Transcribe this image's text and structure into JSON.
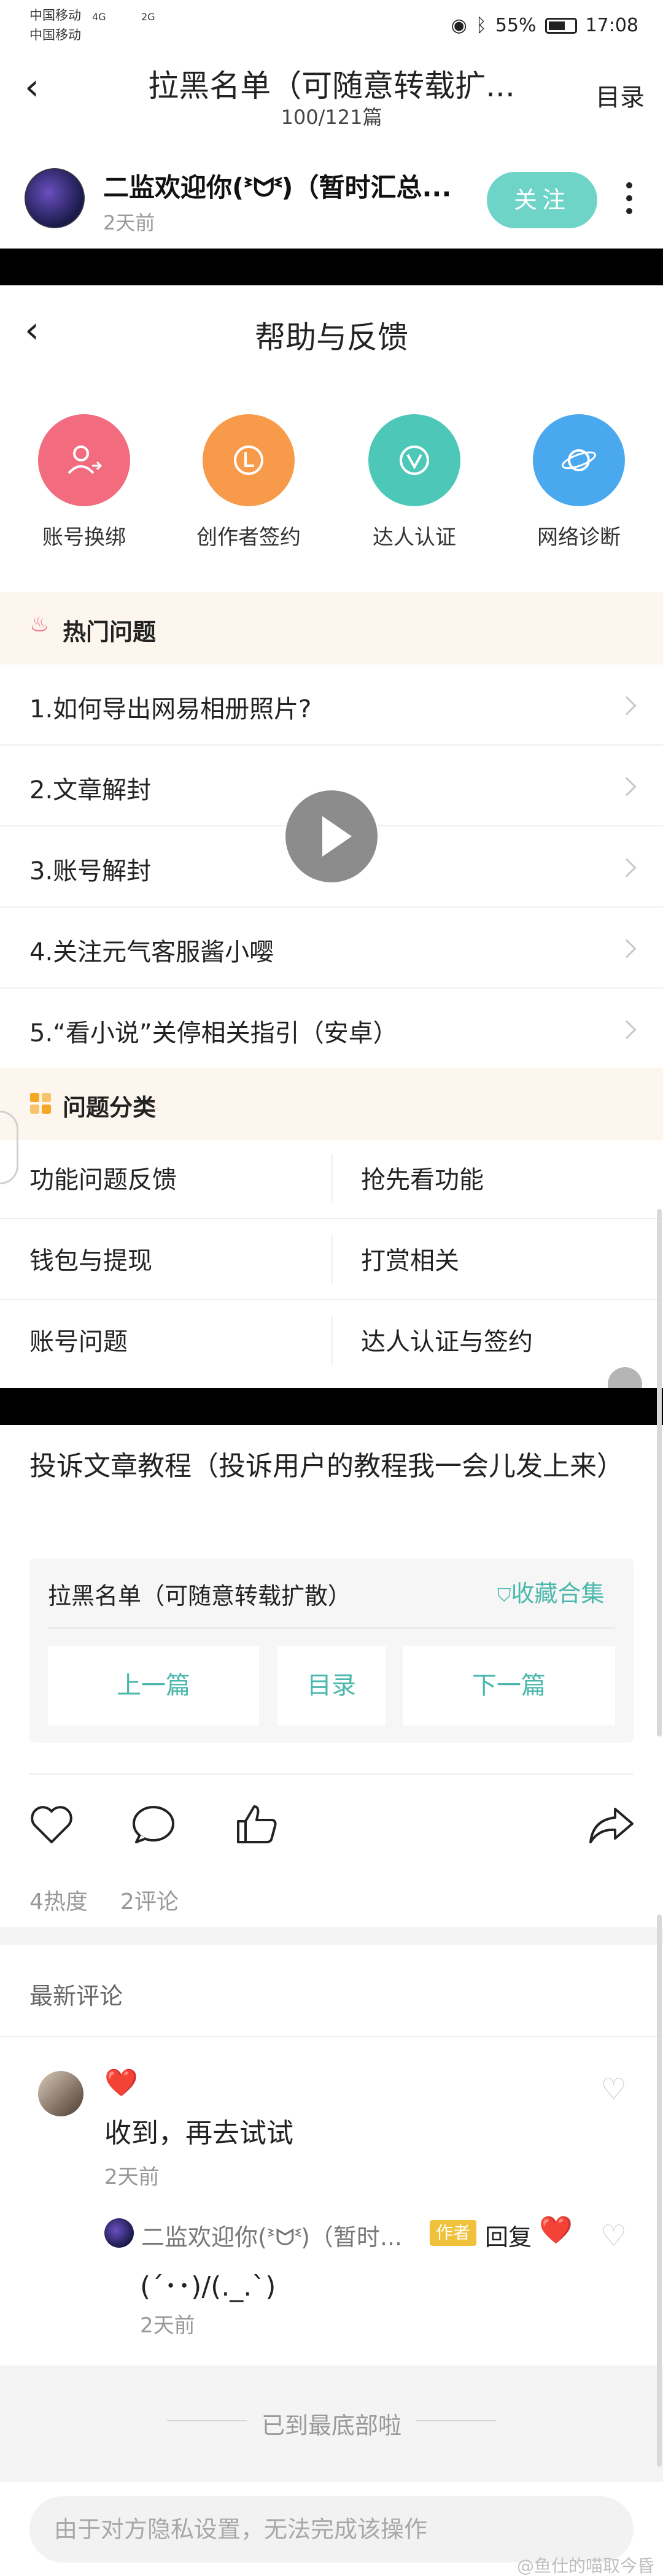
{
  "status_bar": {
    "carrier1": "中国移动",
    "carrier2": "中国移动",
    "network1": "4G",
    "network2": "2G",
    "battery": "55%",
    "time": "17:08"
  },
  "article_header": {
    "title": "拉黑名单（可随意转载扩...",
    "progress": "100/121篇",
    "toc": "目录"
  },
  "author": {
    "name": "二监欢迎你(ᕑᗢᓫ)（暂时汇总...",
    "time": "2天前",
    "follow": "关注"
  },
  "help_page": {
    "title": "帮助与反馈",
    "quick_links": [
      {
        "label": "账号换绑",
        "icon": "account-switch-icon",
        "color": "#f26b7f"
      },
      {
        "label": "创作者签约",
        "icon": "creator-sign-icon",
        "color": "#f79a4a"
      },
      {
        "label": "达人认证",
        "icon": "verified-v-icon",
        "color": "#4dc7b8"
      },
      {
        "label": "网络诊断",
        "icon": "planet-icon",
        "color": "#4aa8ef"
      }
    ],
    "hot_title": "热门问题",
    "hot_questions": [
      "1.如何导出网易相册照片?",
      "2.文章解封",
      "3.账号解封",
      "4.关注元气客服酱小嘤",
      "5.“看小说”关停相关指引（安卓）"
    ],
    "category_title": "问题分类",
    "categories": [
      [
        "功能问题反馈",
        "抢先看功能"
      ],
      [
        "钱包与提现",
        "打赏相关"
      ],
      [
        "账号问题",
        "达人认证与签约"
      ]
    ]
  },
  "article": {
    "body": "投诉文章教程（投诉用户的教程我一会儿发上来）",
    "collection_name": "拉黑名单（可随意转载扩散）",
    "collection_fav": "收藏合集",
    "prev": "上一篇",
    "toc": "目录",
    "next": "下一篇"
  },
  "stats": {
    "heat": "4热度",
    "comments": "2评论"
  },
  "comments": {
    "header": "最新评论",
    "items": [
      {
        "badge": "❤️",
        "text": "收到，再去试试",
        "time": "2天前",
        "reply": {
          "name": "二监欢迎你(ᕑᗢᓫ)（暂时...",
          "tag": "作者",
          "word": "回复",
          "heart": "❤️",
          "text": "(´･･)/(._.`)",
          "time": "2天前"
        }
      }
    ]
  },
  "footer": {
    "end": "已到最底部啦",
    "input_placeholder": "由于对方隐私设置，无法完成该操作"
  },
  "watermark": "@鱼仕的喵取今昏"
}
